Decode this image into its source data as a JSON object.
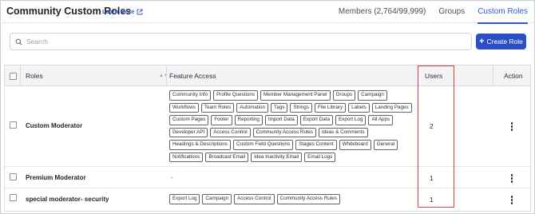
{
  "header": {
    "title": "Community Custom Roles",
    "learn_more": "Learn More",
    "tabs": [
      {
        "label": "Members (2,764/99,999)",
        "active": false
      },
      {
        "label": "Groups",
        "active": false
      },
      {
        "label": "Custom Roles",
        "active": true
      }
    ]
  },
  "search": {
    "placeholder": "Search"
  },
  "create_button": {
    "label": "Create Role"
  },
  "table": {
    "columns": {
      "roles": "Roles",
      "feature_access": "Feature Access",
      "users": "Users",
      "action": "Action"
    },
    "rows": [
      {
        "name": "Custom Moderator",
        "features": [
          "Community Info",
          "Profile Questions",
          "Member Management Panel",
          "Groups",
          "Campaign",
          "Workflows",
          "Team Roles",
          "Automation",
          "Tags",
          "Strings",
          "File Library",
          "Labels",
          "Landing Pages",
          "Custom Pages",
          "Footer",
          "Reporting",
          "Import Data",
          "Export Data",
          "Export Log",
          "All Apps",
          "Developer API",
          "Access Control",
          "Community Access Rules",
          "Ideas & Comments",
          "Headings & Descriptions",
          "Custom Field Questions",
          "Stages Content",
          "Whiteboard",
          "General",
          "Notifications",
          "Broadcast Email",
          "Idea Inactivity Email",
          "Email Logs"
        ],
        "features_empty": "",
        "users": "2"
      },
      {
        "name": "Premium Moderator",
        "features": [],
        "features_empty": "-",
        "users": "1"
      },
      {
        "name": "special moderator- security",
        "features": [
          "Export Log",
          "Campaign",
          "Access Control",
          "Community Access Rules"
        ],
        "features_empty": "",
        "users": "1"
      }
    ]
  },
  "colors": {
    "accent": "#2c5bd3",
    "button": "#2c4fc6",
    "highlight": "#e23b3b"
  }
}
